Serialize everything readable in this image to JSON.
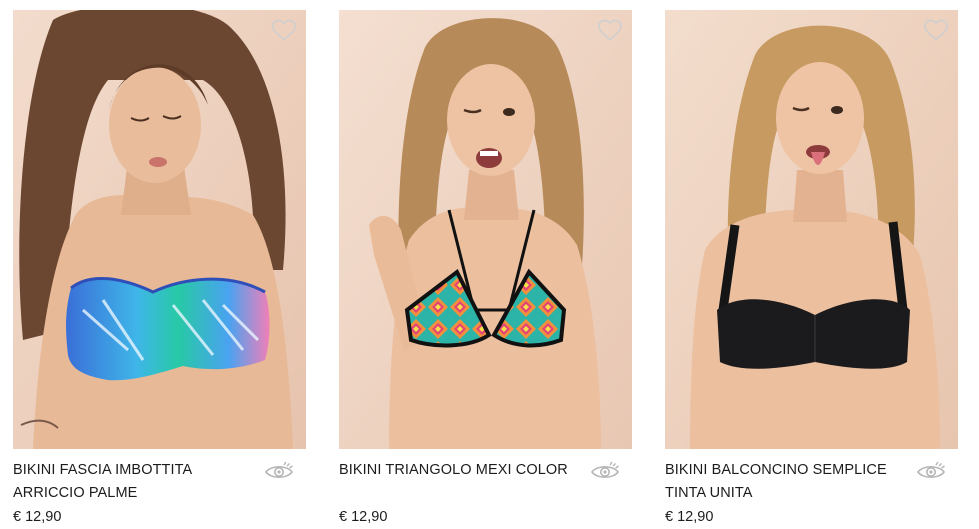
{
  "products": [
    {
      "name": "BIKINI FASCIA IMBOTTITA ARRICCIO PALME",
      "price": "€ 12,90",
      "image_alt": "Bikini fascia imbottita arriccio palme"
    },
    {
      "name": "BIKINI TRIANGOLO MEXI COLOR",
      "price": "€ 12,90",
      "image_alt": "Bikini triangolo mexi color"
    },
    {
      "name": "BIKINI BALCONCINO SEMPLICE TINTA UNITA",
      "price": "€ 12,90",
      "image_alt": "Bikini balconcino semplice tinta unita"
    }
  ],
  "icons": {
    "wishlist": "heart-outline-icon",
    "quickview": "eye-icon"
  },
  "colors": {
    "photo_background": "#eccfbd",
    "icon_gray": "#b5b5b5",
    "text": "#1c1c1c"
  }
}
